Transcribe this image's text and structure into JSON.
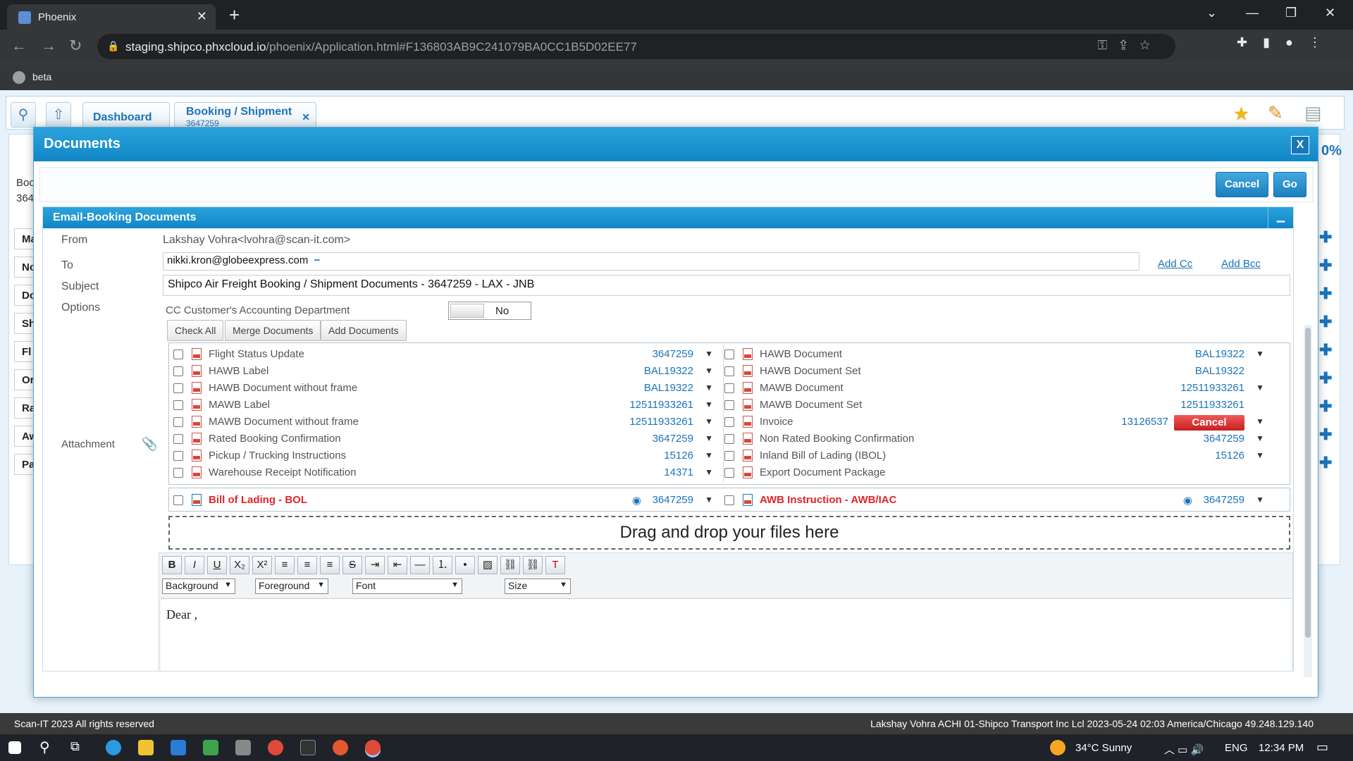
{
  "browser": {
    "tab_title": "Phoenix",
    "url_domain": "staging.shipco.phxcloud.io",
    "url_path": "/phoenix/Application.html#F136803AB9C241079BA0CC1B5D02EE77",
    "bookmark": "beta"
  },
  "app": {
    "tabs": [
      {
        "label": "Dashboard"
      },
      {
        "label": "Booking / Shipment",
        "sub": "3647259"
      }
    ],
    "bg_rows": [
      "Ma",
      "No",
      "Do",
      "Sh",
      "Fl",
      "Or",
      "Ra",
      "Aw",
      "Pa"
    ],
    "bg_label": "Boo",
    "bg_value": "364",
    "percent": "0%",
    "footer_left": "Scan-IT 2023 All rights reserved",
    "footer_right": "Lakshay Vohra ACHI 01-Shipco Transport Inc Lcl 2023-05-24 02:03 America/Chicago 49.248.129.140"
  },
  "modal": {
    "title": "Documents",
    "close": "X",
    "cancel": "Cancel",
    "go": "Go",
    "section_title": "Email-Booking Documents",
    "from_label": "From",
    "from_value": "Lakshay Vohra<lvohra@scan-it.com>",
    "to_label": "To",
    "to_value": "nikki.kron@globeexpress.com",
    "add_cc": "Add Cc",
    "add_bcc": "Add Bcc",
    "subject_label": "Subject",
    "subject_value": "Shipco Air Freight Booking / Shipment Documents - 3647259 - LAX - JNB",
    "options_label": "Options",
    "cc_option": "CC Customer's Accounting Department",
    "toggle_value": "No",
    "attachment_label": "Attachment",
    "check_all": "Check All",
    "merge_documents": "Merge Documents",
    "add_documents": "Add Documents",
    "left_docs": [
      {
        "name": "Flight Status Update",
        "ref": "3647259"
      },
      {
        "name": "HAWB Label",
        "ref": "BAL19322"
      },
      {
        "name": "HAWB Document without frame",
        "ref": "BAL19322"
      },
      {
        "name": "MAWB Label",
        "ref": "12511933261"
      },
      {
        "name": "MAWB Document without frame",
        "ref": "12511933261"
      },
      {
        "name": "Rated Booking Confirmation",
        "ref": "3647259"
      },
      {
        "name": "Pickup / Trucking Instructions",
        "ref": "15126"
      },
      {
        "name": "Warehouse Receipt Notification",
        "ref": "14371"
      }
    ],
    "right_docs": [
      {
        "name": "HAWB Document",
        "ref": "BAL19322"
      },
      {
        "name": "HAWB Document Set",
        "ref": "BAL19322"
      },
      {
        "name": "MAWB Document",
        "ref": "12511933261"
      },
      {
        "name": "MAWB Document Set",
        "ref": "12511933261"
      },
      {
        "name": "Invoice",
        "ref": "13126537",
        "action": "Cancel"
      },
      {
        "name": "Non Rated Booking Confirmation",
        "ref": "3647259"
      },
      {
        "name": "Inland Bill of Lading (IBOL)",
        "ref": "15126"
      },
      {
        "name": "Export Document Package",
        "ref": ""
      }
    ],
    "bol": {
      "name": "Bill of Lading - BOL",
      "ref": "3647259"
    },
    "awb": {
      "name": "AWB Instruction - AWB/IAC",
      "ref": "3647259"
    },
    "dropzone": "Drag and drop your files here",
    "editor": {
      "background": "Background",
      "foreground": "Foreground",
      "font": "Font",
      "size": "Size",
      "body": "Dear ,"
    }
  },
  "taskbar": {
    "weather": "34°C  Sunny",
    "lang": "ENG",
    "time": "12:34 PM"
  }
}
